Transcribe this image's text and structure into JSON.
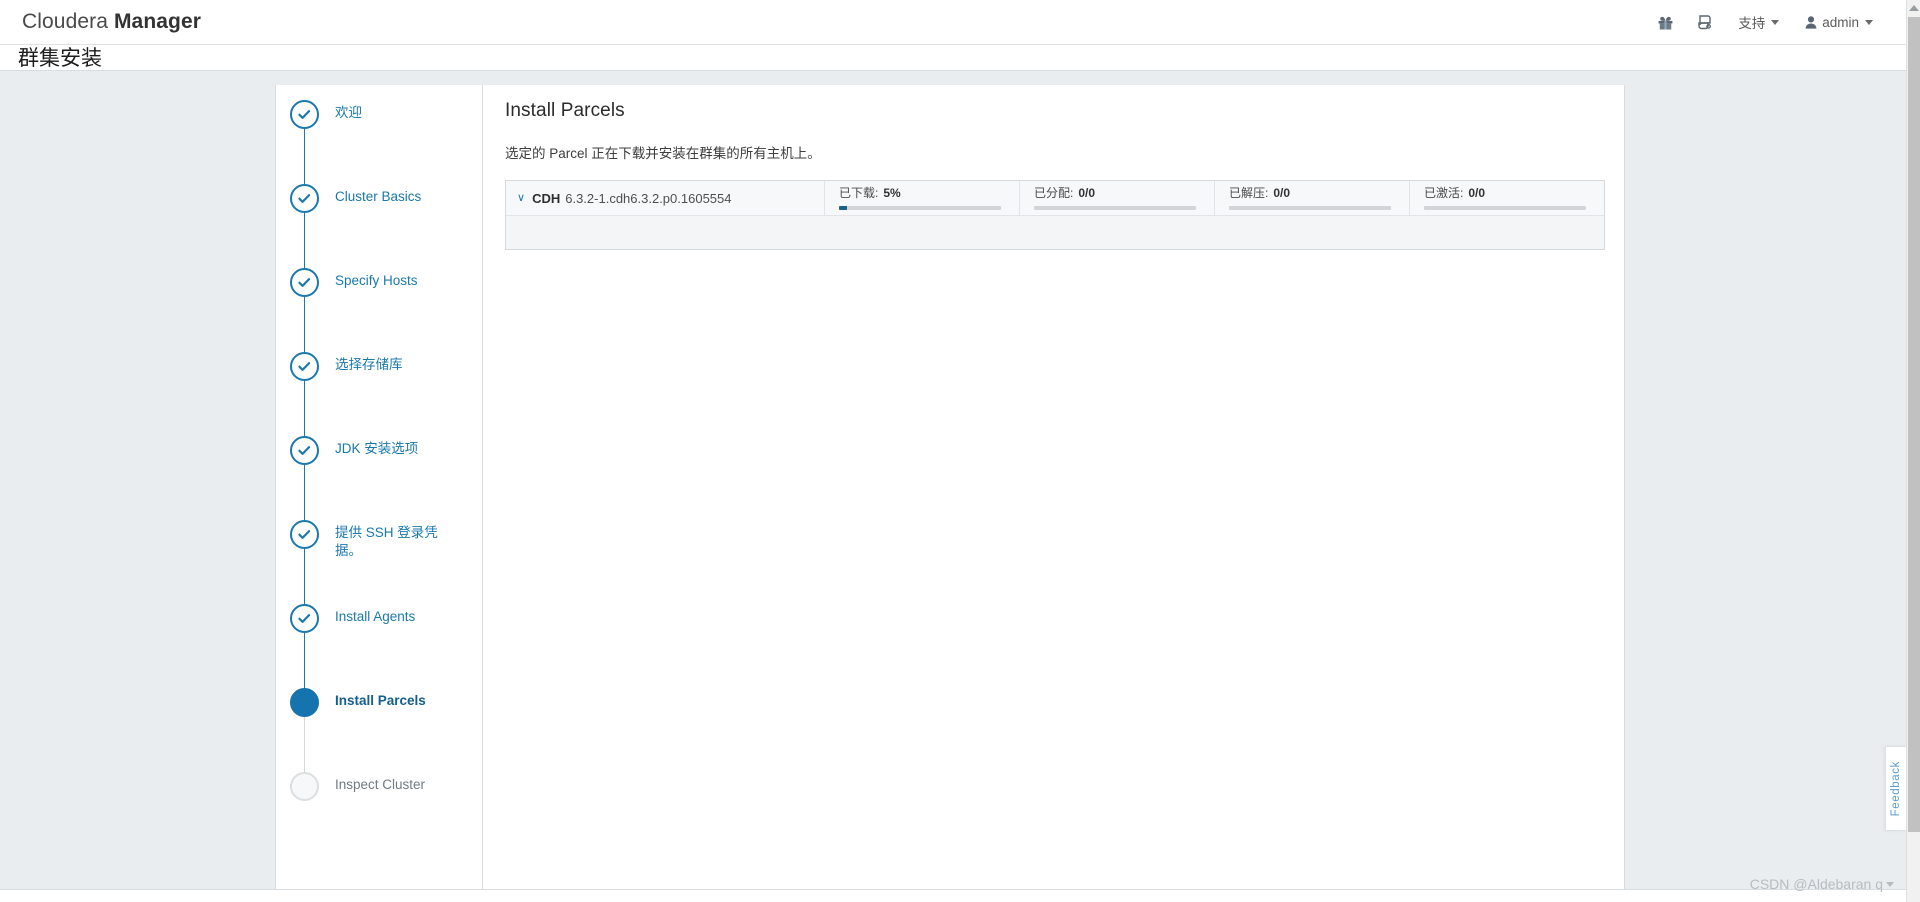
{
  "topbar": {
    "brand_prefix": "Cloudera",
    "brand_suffix": "Manager",
    "gift_icon": "gift-icon",
    "parcel_icon": "parcel-icon",
    "support_label": "支持",
    "user_label": "admin"
  },
  "page": {
    "title": "群集安装"
  },
  "stepper": {
    "items": [
      {
        "label": "欢迎",
        "state": "done"
      },
      {
        "label": "Cluster Basics",
        "state": "done"
      },
      {
        "label": "Specify Hosts",
        "state": "done"
      },
      {
        "label": "选择存储库",
        "state": "done"
      },
      {
        "label": "JDK 安装选项",
        "state": "done"
      },
      {
        "label": "提供 SSH 登录凭据。",
        "state": "done"
      },
      {
        "label": "Install Agents",
        "state": "done"
      },
      {
        "label": "Install Parcels",
        "state": "active"
      },
      {
        "label": "Inspect Cluster",
        "state": "pending"
      }
    ]
  },
  "main": {
    "title": "Install Parcels",
    "description": "选定的 Parcel 正在下载并安装在群集的所有主机上。",
    "parcel": {
      "name": "CDH",
      "version": "6.3.2-1.cdh6.3.2.p0.1605554",
      "expanded": true,
      "progress": [
        {
          "label": "已下载:",
          "value": "5%",
          "percent": 5
        },
        {
          "label": "已分配:",
          "value": "0/0",
          "percent": 0
        },
        {
          "label": "已解压:",
          "value": "0/0",
          "percent": 0
        },
        {
          "label": "已激活:",
          "value": "0/0",
          "percent": 0
        }
      ]
    }
  },
  "feedback": {
    "label": "Feedback"
  },
  "watermark": {
    "text": "CSDN @Aldebaran q"
  },
  "colors": {
    "accent": "#1a79ad",
    "active_step": "#1573ad",
    "progress_fill": "#1f5f8b",
    "page_bg": "#e9edf0"
  }
}
